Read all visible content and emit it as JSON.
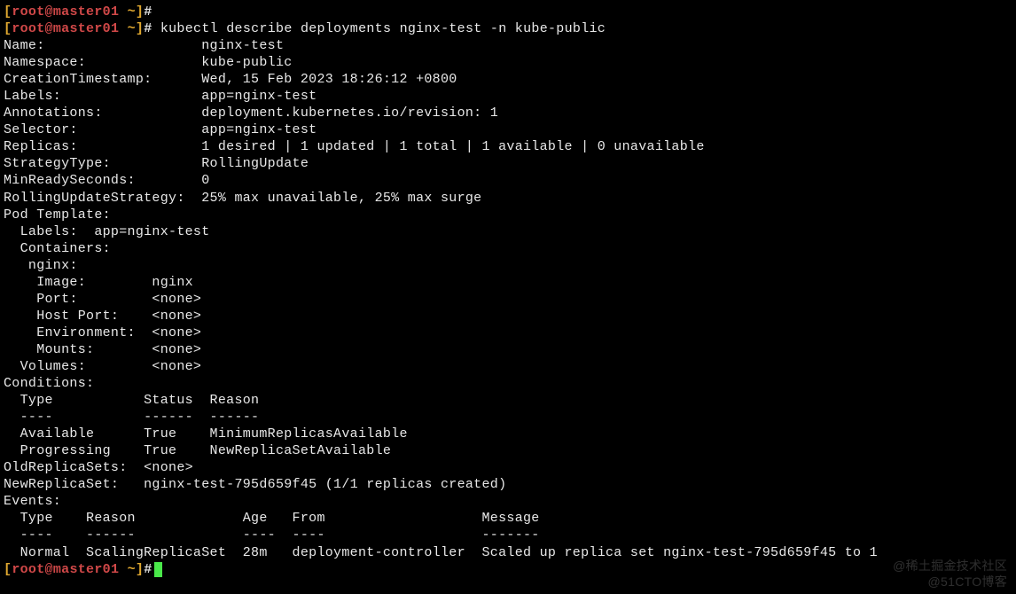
{
  "prompt": {
    "open_bracket": "[",
    "user": "root",
    "at": "@",
    "host": "master01",
    "space": " ",
    "path": "~",
    "close_bracket": "]",
    "hash": "#"
  },
  "command": "kubectl describe deployments nginx-test -n kube-public",
  "output": {
    "l01": "Name:                   nginx-test",
    "l02": "Namespace:              kube-public",
    "l03": "CreationTimestamp:      Wed, 15 Feb 2023 18:26:12 +0800",
    "l04": "Labels:                 app=nginx-test",
    "l05": "Annotations:            deployment.kubernetes.io/revision: 1",
    "l06": "Selector:               app=nginx-test",
    "l07": "Replicas:               1 desired | 1 updated | 1 total | 1 available | 0 unavailable",
    "l08": "StrategyType:           RollingUpdate",
    "l09": "MinReadySeconds:        0",
    "l10": "RollingUpdateStrategy:  25% max unavailable, 25% max surge",
    "l11": "Pod Template:",
    "l12": "  Labels:  app=nginx-test",
    "l13": "  Containers:",
    "l14": "   nginx:",
    "l15": "    Image:        nginx",
    "l16": "    Port:         <none>",
    "l17": "    Host Port:    <none>",
    "l18": "    Environment:  <none>",
    "l19": "    Mounts:       <none>",
    "l20": "  Volumes:        <none>",
    "l21": "Conditions:",
    "l22": "  Type           Status  Reason",
    "l23": "  ----           ------  ------",
    "l24": "  Available      True    MinimumReplicasAvailable",
    "l25": "  Progressing    True    NewReplicaSetAvailable",
    "l26": "OldReplicaSets:  <none>",
    "l27": "NewReplicaSet:   nginx-test-795d659f45 (1/1 replicas created)",
    "l28": "Events:",
    "l29": "  Type    Reason             Age   From                   Message",
    "l30": "  ----    ------             ----  ----                   -------",
    "l31": "  Normal  ScalingReplicaSet  28m   deployment-controller  Scaled up replica set nginx-test-795d659f45 to 1"
  },
  "watermark": {
    "line1": "@稀土掘金技术社区",
    "line2": "@51CTO博客"
  }
}
